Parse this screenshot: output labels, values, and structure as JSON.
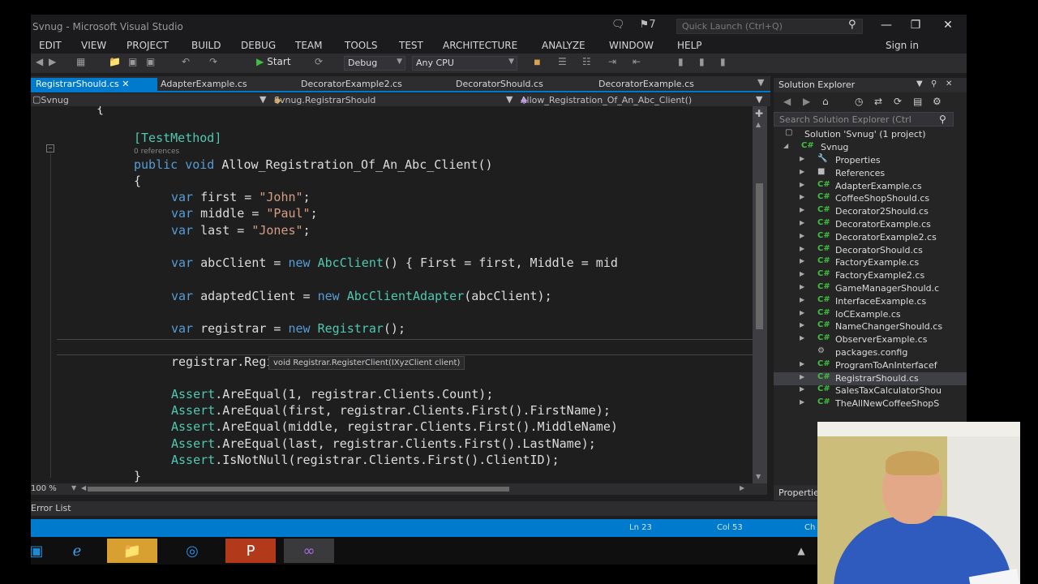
{
  "window": {
    "title": "Svnug - Microsoft Visual Studio",
    "quick_launch_placeholder": "Quick Launch (Ctrl+Q)",
    "notification_count": "7",
    "sign_in": "Sign in"
  },
  "menu": [
    "EDIT",
    "VIEW",
    "PROJECT",
    "BUILD",
    "DEBUG",
    "TEAM",
    "TOOLS",
    "TEST",
    "ARCHITECTURE",
    "ANALYZE",
    "WINDOW",
    "HELP"
  ],
  "toolbar": {
    "start_label": "Start",
    "config": "Debug",
    "platform": "Any CPU"
  },
  "tabs": [
    "RegistrarShould.cs",
    "AdapterExample.cs",
    "DecoratorExample2.cs",
    "DecoratorShould.cs",
    "DecoratorExample.cs"
  ],
  "navbar": {
    "project": "Svnug",
    "class": "Svnug.RegistrarShould",
    "member": "Allow_Registration_Of_An_Abc_Client()"
  },
  "code": {
    "brace_top": "{",
    "attribute": "[TestMethod]",
    "references": "0 references",
    "line_sig_kw1": "public",
    "line_sig_kw2": "void",
    "line_sig_name": "Allow_Registration_Of_An_Abc_Client()",
    "brace_open": "{",
    "var_kw": "var",
    "first_decl": "first = ",
    "first_val": "\"John\"",
    "middle_decl": "middle = ",
    "middle_val": "\"Paul\"",
    "last_decl": "last = ",
    "last_val": "\"Jones\"",
    "semi": ";",
    "abc_decl": "abcClient = ",
    "new_kw": "new",
    "abc_type": "AbcClient",
    "abc_rest": "() { First = first, Middle = mid",
    "adapted_decl": "adaptedClient = ",
    "adapter_type": "AbcClientAdapter",
    "adapter_rest": "(abcClient);",
    "registrar_decl": "registrar = ",
    "registrar_type": "Registrar",
    "registrar_rest": "();",
    "register_call": "registrar.RegisterClient(adaptedClient);",
    "tooltip": "void Registrar.RegisterClient(IXyzClient client)",
    "assert_type": "Assert",
    "assert1": ".AreEqual(1, registrar.Clients.Count);",
    "assert2": ".AreEqual(first, registrar.Clients.First().FirstName);",
    "assert3": ".AreEqual(middle, registrar.Clients.First().MiddleName)",
    "assert4": ".AreEqual(last, registrar.Clients.First().LastName);",
    "assert5": ".IsNotNull(registrar.Clients.First().ClientID);",
    "brace_close_inner": "}",
    "brace_close_outer": "}"
  },
  "editor_footer": {
    "zoom": "100 %",
    "error_list": "Error List"
  },
  "status": {
    "line": "Ln 23",
    "col": "Col 53",
    "ch": "Ch"
  },
  "solution_explorer": {
    "title": "Solution Explorer",
    "search_placeholder": "Search Solution Explorer (Ctrl",
    "solution": "Solution 'Svnug' (1 project)",
    "project": "Svnug",
    "items": [
      "Properties",
      "References",
      "AdapterExample.cs",
      "CoffeeShopShould.cs",
      "Decorator2Should.cs",
      "DecoratorExample.cs",
      "DecoratorExample2.cs",
      "DecoratorShould.cs",
      "FactoryExample.cs",
      "FactoryExample2.cs",
      "GameManagerShould.c",
      "InterfaceExample.cs",
      "IoCExample.cs",
      "NameChangerShould.cs",
      "ObserverExample.cs",
      "packages.config",
      "ProgramToAnInterfacef",
      "RegistrarShould.cs",
      "SalesTaxCalculatorShou",
      "TheAllNewCoffeeShopS"
    ],
    "selected_index": 17,
    "properties_tab": "Properties"
  },
  "colors": {
    "accent": "#007acc",
    "keyword": "#569cd6",
    "string": "#d69d85",
    "type": "#4ec9b0"
  }
}
